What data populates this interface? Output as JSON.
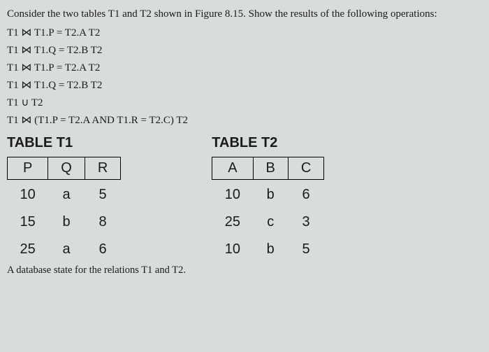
{
  "intro": "Consider the two tables T1 and T2 shown in Figure 8.15. Show the results of the following operations:",
  "ops": {
    "op1": "T1 ⋈ T1.P = T2.A T2",
    "op2": "T1 ⋈ T1.Q = T2.B T2",
    "op3": "T1 ⋈ T1.P = T2.A T2",
    "op4": "T1 ⋈ T1.Q = T2.B T2",
    "op5": "T1 ∪ T2",
    "op6": "T1 ⋈ (T1.P = T2.A AND T1.R = T2.C) T2"
  },
  "table1": {
    "title": "TABLE T1",
    "headers": {
      "h0": "P",
      "h1": "Q",
      "h2": "R"
    },
    "rows": [
      {
        "c0": "10",
        "c1": "a",
        "c2": "5"
      },
      {
        "c0": "15",
        "c1": "b",
        "c2": "8"
      },
      {
        "c0": "25",
        "c1": "a",
        "c2": "6"
      }
    ]
  },
  "table2": {
    "title": "TABLE T2",
    "headers": {
      "h0": "A",
      "h1": "B",
      "h2": "C"
    },
    "rows": [
      {
        "c0": "10",
        "c1": "b",
        "c2": "6"
      },
      {
        "c0": "25",
        "c1": "c",
        "c2": "3"
      },
      {
        "c0": "10",
        "c1": "b",
        "c2": "5"
      }
    ]
  },
  "caption": "A database state for the relations T1 and T2."
}
